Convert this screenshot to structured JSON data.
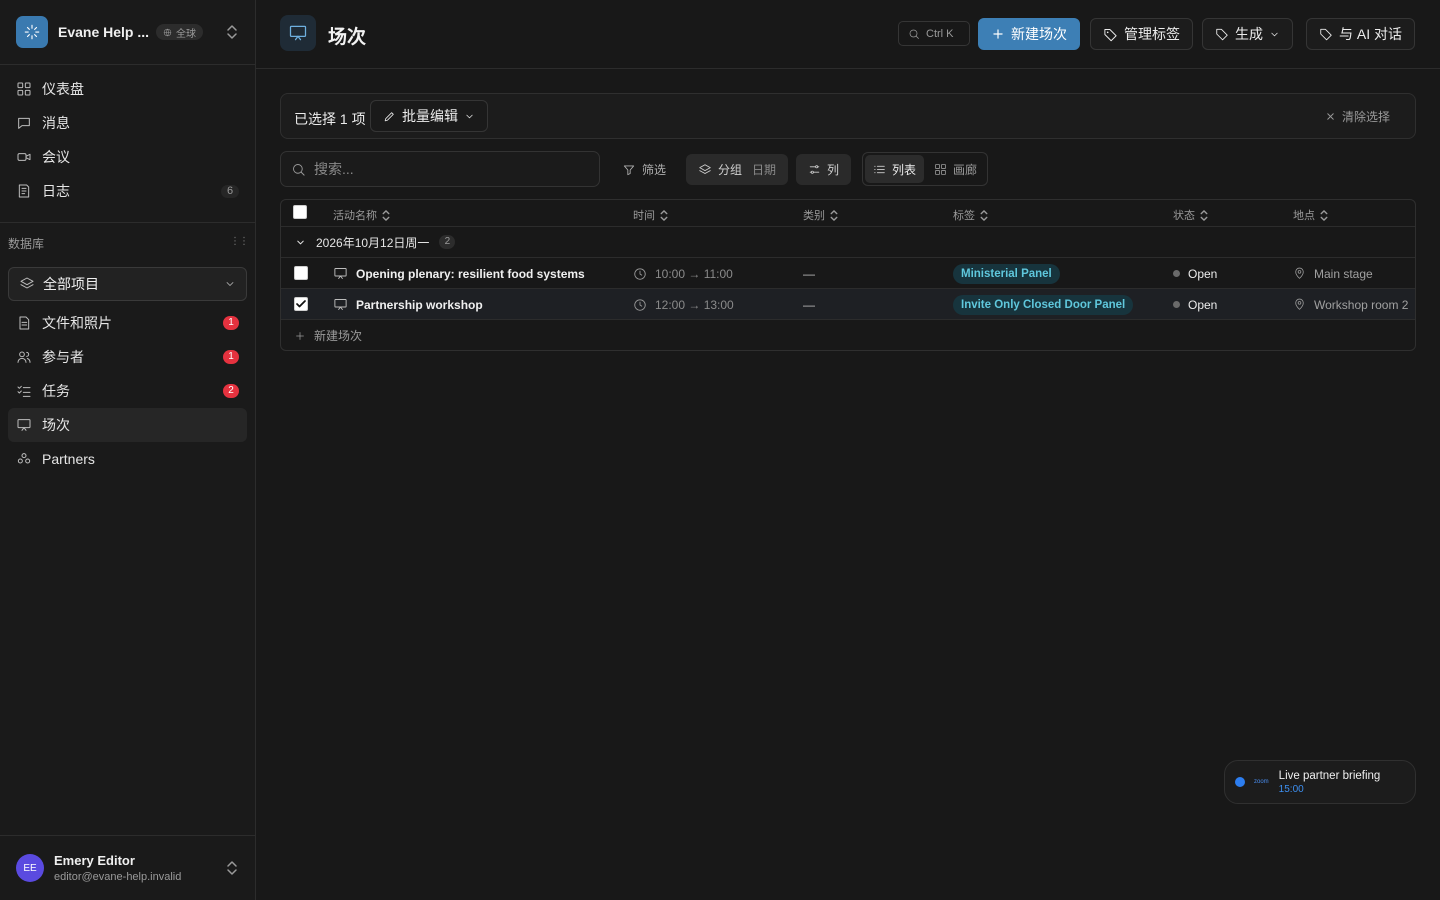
{
  "workspace": {
    "name": "Evane Help ...",
    "badge": "全球"
  },
  "sidebar": {
    "top_items": [
      {
        "label": "仪表盘",
        "icon": "dashboard-icon",
        "count": ""
      },
      {
        "label": "消息",
        "icon": "message-icon",
        "count": ""
      },
      {
        "label": "会议",
        "icon": "video-icon",
        "count": ""
      },
      {
        "label": "日志",
        "icon": "log-icon",
        "count": "6"
      }
    ],
    "db_label": "数据库",
    "db_select": "全部项目",
    "db_items": [
      {
        "label": "文件和照片",
        "icon": "file-icon",
        "count": "1"
      },
      {
        "label": "参与者",
        "icon": "users-icon",
        "count": "1"
      },
      {
        "label": "任务",
        "icon": "tasks-icon",
        "count": "2"
      },
      {
        "label": "场次",
        "icon": "presentation-icon",
        "count": "",
        "active": true
      },
      {
        "label": "Partners",
        "icon": "partners-icon",
        "count": ""
      }
    ]
  },
  "user": {
    "initials": "EE",
    "name": "Emery Editor",
    "email": "editor@evane-help.invalid"
  },
  "header": {
    "title": "场次",
    "shortcut": "Ctrl K",
    "new_button": "新建场次",
    "manage_tags": "管理标签",
    "generate": "生成",
    "ai_chat": "与 AI 对话"
  },
  "selection": {
    "count_label": "已选择 1 项",
    "bulk_edit": "批量编辑",
    "clear": "清除选择"
  },
  "toolbar": {
    "search_placeholder": "搜索...",
    "filter": "筛选",
    "group": "分组",
    "group_value": "日期",
    "columns": "列",
    "view_list": "列表",
    "view_gallery": "画廊"
  },
  "table": {
    "columns": [
      "活动名称",
      "时间",
      "类别",
      "标签",
      "状态",
      "地点"
    ],
    "group": {
      "label": "2026年10月12日周一",
      "count": "2"
    },
    "rows": [
      {
        "name": "Opening plenary: resilient food systems",
        "time": "10:00 → 11:00",
        "category": "—",
        "tag": "Ministerial Panel",
        "status": "Open",
        "location": "Main stage",
        "selected": false
      },
      {
        "name": "Partnership workshop",
        "time": "12:00 → 13:00",
        "category": "—",
        "tag": "Invite Only Closed Door Panel",
        "status": "Open",
        "location": "Workshop room 2",
        "selected": true
      }
    ],
    "add_row": "新建场次"
  },
  "toast": {
    "brand": "zoom",
    "title": "Live partner briefing",
    "time": "15:00"
  },
  "colors": {
    "accent": "#3d7fb5",
    "tag_bg": "#17343d",
    "tag_text": "#5fc7dc",
    "badge_red": "#e5323f"
  }
}
